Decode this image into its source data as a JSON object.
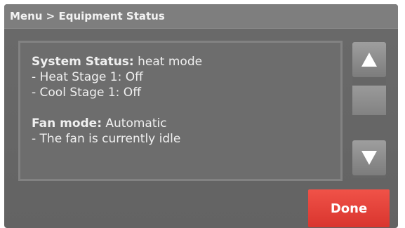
{
  "header": {
    "breadcrumb": "Menu > Equipment Status"
  },
  "status": {
    "system_label": "System Status:",
    "system_value": "heat mode",
    "heat_stage": "- Heat Stage 1: Off",
    "cool_stage": "- Cool Stage 1: Off",
    "fan_label": "Fan mode:",
    "fan_value": "Automatic",
    "fan_state": "- The fan is currently idle"
  },
  "scroll": {
    "up_icon": "triangle-up-icon",
    "down_icon": "triangle-down-icon"
  },
  "actions": {
    "done_label": "Done",
    "done_color": "#e8413a"
  }
}
